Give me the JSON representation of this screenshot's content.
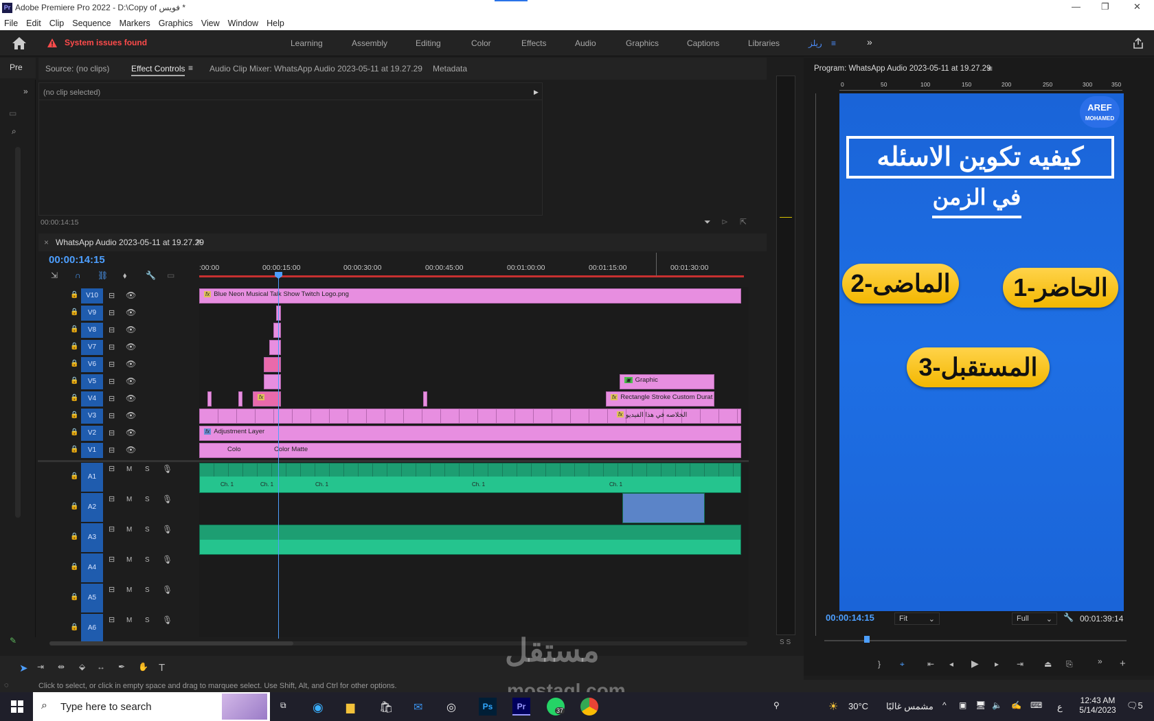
{
  "window": {
    "title": "Adobe Premiere Pro 2022 - D:\\Copy of فويس  *",
    "app_badge": "Pr"
  },
  "menu": [
    "File",
    "Edit",
    "Clip",
    "Sequence",
    "Markers",
    "Graphics",
    "View",
    "Window",
    "Help"
  ],
  "workspace": {
    "system_issues": "System issues found",
    "tabs": [
      "Learning",
      "Assembly",
      "Editing",
      "Color",
      "Effects",
      "Audio",
      "Graphics",
      "Captions",
      "Libraries"
    ],
    "custom": "ريلز"
  },
  "source_panel": {
    "pre_tab": "Pre",
    "tabs": [
      "Source: (no clips)",
      "Effect Controls",
      "Audio Clip Mixer: WhatsApp Audio 2023-05-11 at 19.27.29",
      "Metadata"
    ],
    "no_clip": "(no clip selected)",
    "timecode": "00:00:14:15"
  },
  "timeline": {
    "sequence_name": "WhatsApp Audio 2023-05-11 at 19.27.29",
    "timecode": "00:00:14:15",
    "ruler": [
      ":00:00",
      "00:00:15:00",
      "00:00:30:00",
      "00:00:45:00",
      "00:01:00:00",
      "00:01:15:00",
      "00:01:30:00"
    ],
    "video_tracks": [
      "V10",
      "V9",
      "V8",
      "V7",
      "V6",
      "V5",
      "V4",
      "V3",
      "V2",
      "V1"
    ],
    "audio_tracks": [
      "A1",
      "A2",
      "A3",
      "A4",
      "A5",
      "A6"
    ],
    "audio_buttons": {
      "m": "M",
      "s": "S"
    },
    "clips": {
      "v10": "Blue Neon Musical Talk Show Twitch Logo.png",
      "v5": "Graphic",
      "v4": "Rectangle Stroke Custom Durat",
      "v3": "الخلاصه في هذا الفيديو",
      "v2": "Adjustment Layer",
      "v1a": "Colo",
      "v1b": "Color Matte",
      "fx": "fx",
      "ch": "Ch. 1"
    }
  },
  "meter": {
    "ss": "S S"
  },
  "program": {
    "title": "Program: WhatsApp Audio 2023-05-11 at 19.27.29",
    "ruler": [
      "0",
      "50",
      "100",
      "150",
      "200",
      "250",
      "300",
      "350"
    ],
    "timecode": "00:00:14:15",
    "fit": "Fit",
    "quality": "Full",
    "duration": "00:01:39:14",
    "frame": {
      "logo_line1": "AREF",
      "logo_line2": "MOHAMED",
      "title": "كيفيه تكوين الاسئله",
      "subtitle": "في الزمن",
      "item1": "1-الحاضر",
      "item2": "2-الماضى",
      "item3": "3-المستقبل"
    }
  },
  "status": "Click to select, or click in empty space and drag to marquee select. Use Shift, Alt, and Ctrl for other options.",
  "watermark": {
    "logo": "مستقل",
    "site": "mostaql.com"
  },
  "taskbar": {
    "search": "Type here to search",
    "temp": "30°C",
    "weather": "مشمس غالبًا",
    "time": "12:43 AM",
    "date": "5/14/2023",
    "lang": "ع",
    "badge": "37",
    "notif": "5"
  }
}
